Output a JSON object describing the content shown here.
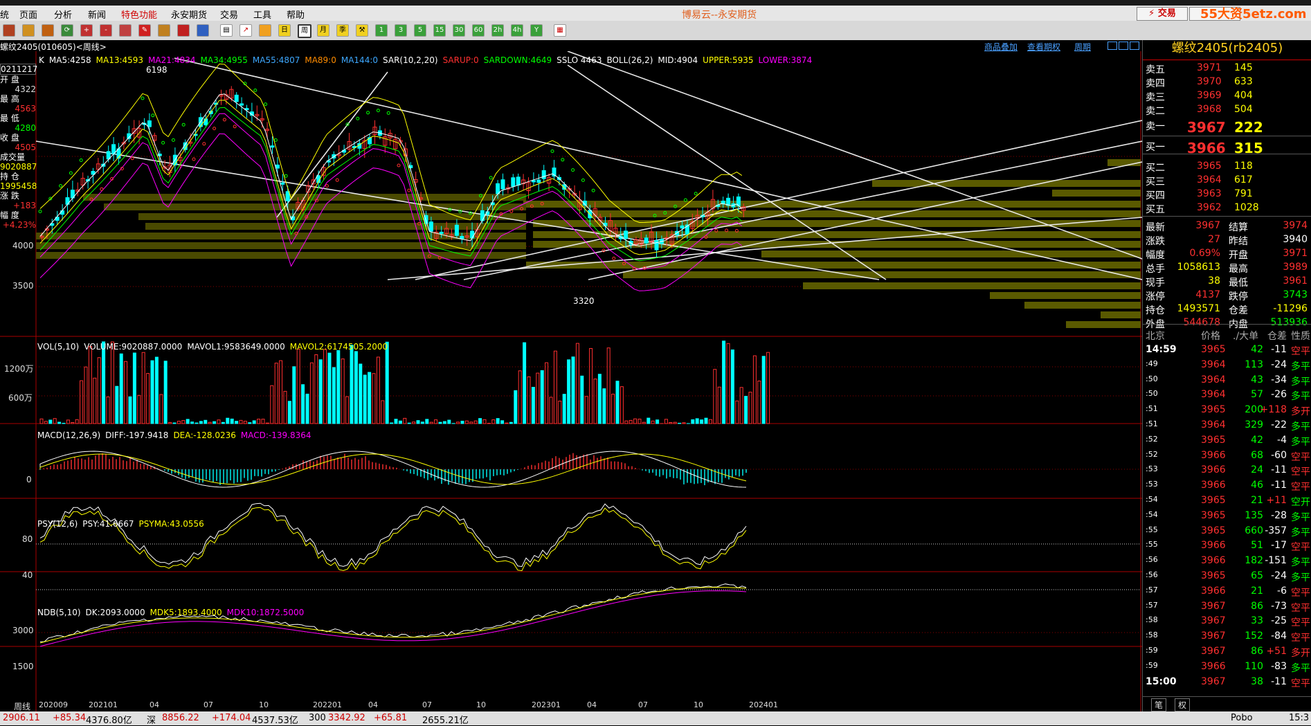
{
  "menubar": {
    "items": [
      "统",
      "页面",
      "分析",
      "新闻",
      "特色功能",
      "永安期货",
      "交易",
      "工具",
      "帮助"
    ],
    "title": "博易云--永安期货",
    "trade_button": "⚡ 交易",
    "watermark": "55大资5etz.com"
  },
  "toolbar": {
    "buttons": [
      "1",
      "3",
      "5",
      "15",
      "30",
      "60",
      "2h",
      "4h",
      "Y"
    ]
  },
  "chart_header": {
    "symbol_label": "螺纹2405(010605)<周线>",
    "links": [
      "商品叠加",
      "查看期权",
      "周期"
    ]
  },
  "indicators": {
    "main": [
      {
        "text": "K",
        "color": "#ffffff"
      },
      {
        "text": "MA5:4258",
        "color": "#ffffff"
      },
      {
        "text": "MA13:4593",
        "color": "#ffff00"
      },
      {
        "text": "MA21:4834",
        "color": "#ff00ff"
      },
      {
        "text": "MA34:4955",
        "color": "#00ff00"
      },
      {
        "text": "MA55:4807",
        "color": "#3ea8ff"
      },
      {
        "text": "MA89:0",
        "color": "#ff8c00"
      },
      {
        "text": "MA144:0",
        "color": "#3ea8ff"
      },
      {
        "text": "SAR(10,2,20)",
        "color": "#ffffff"
      },
      {
        "text": "SARUP:0",
        "color": "#ff3030"
      },
      {
        "text": "SARDOWN:4649",
        "color": "#00ff00"
      },
      {
        "text": "SSLO 4463",
        "color": "#ffffff"
      },
      {
        "text": "BOLL(26,2)",
        "color": "#ffffff"
      },
      {
        "text": "MID:4904",
        "color": "#ffffff"
      },
      {
        "text": "UPPER:5935",
        "color": "#ffff00"
      },
      {
        "text": "LOWER:3874",
        "color": "#ff00ff"
      }
    ],
    "vol": [
      {
        "text": "VOL(5,10)",
        "color": "#ffffff"
      },
      {
        "text": "VOLUME:9020887.0000",
        "color": "#ffffff"
      },
      {
        "text": "MAVOL1:9583649.0000",
        "color": "#ffffff"
      },
      {
        "text": "MAVOL2:6174505.2000",
        "color": "#ffff00"
      }
    ],
    "macd": [
      {
        "text": "MACD(12,26,9)",
        "color": "#ffffff"
      },
      {
        "text": "DIFF:-197.9418",
        "color": "#ffffff"
      },
      {
        "text": "DEA:-128.0236",
        "color": "#ffff00"
      },
      {
        "text": "MACD:-139.8364",
        "color": "#ff00ff"
      }
    ],
    "psy": [
      {
        "text": "PSY(12,6)",
        "color": "#ffffff"
      },
      {
        "text": "PSY:41.6667",
        "color": "#ffffff"
      },
      {
        "text": "PSYMA:43.0556",
        "color": "#ffff00"
      }
    ],
    "ndb": [
      {
        "text": "NDB(5,10)",
        "color": "#ffffff"
      },
      {
        "text": "DK:2093.0000",
        "color": "#ffffff"
      },
      {
        "text": "MDK5:1893.4000",
        "color": "#ffff00"
      },
      {
        "text": "MDK10:1872.5000",
        "color": "#ff00ff"
      }
    ]
  },
  "left_info": {
    "date": "0211217",
    "rows": [
      {
        "label": "开  盘",
        "value": "4322",
        "color": "#dddddd"
      },
      {
        "label": "最  高",
        "value": "4563",
        "color": "#ff3030"
      },
      {
        "label": "最  低",
        "value": "4280",
        "color": "#00ff00"
      },
      {
        "label": "收  盘",
        "value": "4505",
        "color": "#ff3030"
      },
      {
        "label": "成交量",
        "value": "9020887",
        "color": "#ffff00"
      },
      {
        "label": "持  仓",
        "value": "1995458",
        "color": "#ffff00"
      },
      {
        "label": "涨  跌",
        "value": "+183",
        "color": "#ff3030"
      },
      {
        "label": "幅  度",
        "value": "+4.23%",
        "color": "#ff3030"
      }
    ]
  },
  "axis_labels": {
    "main": [
      "4000",
      "3500"
    ],
    "vol": [
      "1200万",
      "600万"
    ],
    "macd": [
      "0"
    ],
    "psy": [
      "80",
      "40"
    ],
    "ndb": [
      "3000",
      "1500"
    ],
    "x": [
      "202009",
      "202101",
      "04",
      "07",
      "10",
      "202201",
      "04",
      "07",
      "10",
      "202301",
      "04",
      "07",
      "10",
      "202401"
    ],
    "x_corner": "周线",
    "price_marks": [
      "6198",
      "3320"
    ]
  },
  "quote": {
    "title": "螺纹2405(rb2405)",
    "asks": [
      {
        "label": "卖五",
        "price": "3971",
        "vol": "145"
      },
      {
        "label": "卖四",
        "price": "3970",
        "vol": "633"
      },
      {
        "label": "卖三",
        "price": "3969",
        "vol": "404"
      },
      {
        "label": "卖二",
        "price": "3968",
        "vol": "504"
      },
      {
        "label": "卖一",
        "price": "3967",
        "vol": "222"
      }
    ],
    "bids": [
      {
        "label": "买一",
        "price": "3966",
        "vol": "315"
      },
      {
        "label": "买二",
        "price": "3965",
        "vol": "118"
      },
      {
        "label": "买三",
        "price": "3964",
        "vol": "617"
      },
      {
        "label": "买四",
        "price": "3963",
        "vol": "791"
      },
      {
        "label": "买五",
        "price": "3962",
        "vol": "1028"
      }
    ],
    "stats": [
      {
        "l1": "最新",
        "v1": "3967",
        "c1": "#ff3030",
        "l2": "结算",
        "v2": "3974",
        "c2": "#ff3030"
      },
      {
        "l1": "涨跌",
        "v1": "27",
        "c1": "#ff3030",
        "l2": "昨结",
        "v2": "3940",
        "c2": "#ffffff"
      },
      {
        "l1": "幅度",
        "v1": "0.69%",
        "c1": "#ff3030",
        "l2": "开盘",
        "v2": "3971",
        "c2": "#ff3030"
      },
      {
        "l1": "总手",
        "v1": "1058613",
        "c1": "#ffff00",
        "l2": "最高",
        "v2": "3989",
        "c2": "#ff3030"
      },
      {
        "l1": "现手",
        "v1": "38",
        "c1": "#ffff00",
        "l2": "最低",
        "v2": "3961",
        "c2": "#ff3030"
      },
      {
        "l1": "涨停",
        "v1": "4137",
        "c1": "#ff3030",
        "l2": "跌停",
        "v2": "3743",
        "c2": "#00ff00"
      },
      {
        "l1": "持仓",
        "v1": "1493571",
        "c1": "#ffff00",
        "l2": "仓差",
        "v2": "-11296",
        "c2": "#ffff00"
      },
      {
        "l1": "外盘",
        "v1": "544678",
        "c1": "#ff3030",
        "l2": "内盘",
        "v2": "513936",
        "c2": "#00ff00"
      }
    ],
    "tick_header": [
      "北京",
      "价格",
      "./大单",
      "仓差",
      "性质"
    ],
    "ticks": [
      {
        "t": "14:59",
        "p": "3965",
        "v": "42",
        "d": "-11",
        "n": "空平"
      },
      {
        "t": ":49",
        "p": "3964",
        "v": "113",
        "d": "-24",
        "n": "多平"
      },
      {
        "t": ":50",
        "p": "3964",
        "v": "43",
        "d": "-34",
        "n": "多平"
      },
      {
        "t": ":50",
        "p": "3964",
        "v": "57",
        "d": "-26",
        "n": "多平"
      },
      {
        "t": ":51",
        "p": "3965",
        "v": "200",
        "d": "+118",
        "n": "多开"
      },
      {
        "t": ":51",
        "p": "3964",
        "v": "329",
        "d": "-22",
        "n": "多平"
      },
      {
        "t": ":52",
        "p": "3965",
        "v": "42",
        "d": "-4",
        "n": "多平"
      },
      {
        "t": ":52",
        "p": "3966",
        "v": "68",
        "d": "-60",
        "n": "空平"
      },
      {
        "t": ":53",
        "p": "3966",
        "v": "24",
        "d": "-11",
        "n": "空平"
      },
      {
        "t": ":53",
        "p": "3966",
        "v": "46",
        "d": "-11",
        "n": "空平"
      },
      {
        "t": ":54",
        "p": "3965",
        "v": "21",
        "d": "+11",
        "n": "空开"
      },
      {
        "t": ":54",
        "p": "3965",
        "v": "135",
        "d": "-28",
        "n": "多平"
      },
      {
        "t": ":55",
        "p": "3965",
        "v": "660",
        "d": "-357",
        "n": "多平"
      },
      {
        "t": ":55",
        "p": "3966",
        "v": "51",
        "d": "-17",
        "n": "空平"
      },
      {
        "t": ":56",
        "p": "3966",
        "v": "182",
        "d": "-151",
        "n": "多平"
      },
      {
        "t": ":56",
        "p": "3965",
        "v": "65",
        "d": "-24",
        "n": "多平"
      },
      {
        "t": ":57",
        "p": "3966",
        "v": "21",
        "d": "-6",
        "n": "空平"
      },
      {
        "t": ":57",
        "p": "3967",
        "v": "86",
        "d": "-73",
        "n": "空平"
      },
      {
        "t": ":58",
        "p": "3967",
        "v": "33",
        "d": "-25",
        "n": "空平"
      },
      {
        "t": ":58",
        "p": "3967",
        "v": "152",
        "d": "-84",
        "n": "空平"
      },
      {
        "t": ":59",
        "p": "3967",
        "v": "86",
        "d": "+51",
        "n": "多开"
      },
      {
        "t": ":59",
        "p": "3966",
        "v": "110",
        "d": "-83",
        "n": "多平"
      },
      {
        "t": "15:00",
        "p": "3967",
        "v": "38",
        "d": "-11",
        "n": "空平"
      }
    ],
    "tabs": [
      "笔",
      "权"
    ]
  },
  "bottom_bar": [
    {
      "text": "2906.11",
      "color": "#cc0000"
    },
    {
      "text": "+85.34",
      "color": "#cc0000"
    },
    {
      "text": "4376.80亿",
      "color": "#000000"
    },
    {
      "text": "深",
      "color": "#000000"
    },
    {
      "text": "8856.22",
      "color": "#cc0000"
    },
    {
      "text": "+174.04",
      "color": "#cc0000"
    },
    {
      "text": "4537.53亿",
      "color": "#000000"
    },
    {
      "text": "300",
      "color": "#000000"
    },
    {
      "text": "3342.92",
      "color": "#cc0000"
    },
    {
      "text": "+65.81",
      "color": "#cc0000"
    },
    {
      "text": "2655.21亿",
      "color": "#000000"
    },
    {
      "text": "Pobo",
      "color": "#000000"
    },
    {
      "text": "15:3",
      "color": "#000000"
    }
  ],
  "colors": {
    "up": "#ff3030",
    "down": "#00ffff",
    "bg": "#000000",
    "grid": "#8b0000"
  }
}
